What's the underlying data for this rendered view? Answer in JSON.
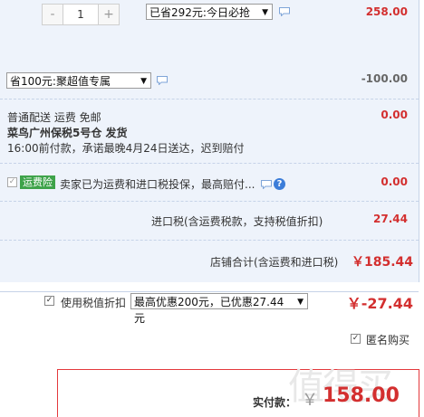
{
  "item": {
    "qty_minus": "-",
    "qty_value": "1",
    "qty_plus": "+",
    "promo_select": "已省292元:今日必抢",
    "price": "258.00"
  },
  "coupon": {
    "select": "省100元:聚超值专属",
    "amount": "-100.00"
  },
  "shipping": {
    "line1": "普通配送 运费 免邮",
    "line2": "菜鸟广州保税5号仓  发货",
    "line3": "16:00前付款，承诺最晚4月24日送达，迟到赔付",
    "amount": "0.00"
  },
  "insurance": {
    "tag": "运费险",
    "text": "卖家已为运费和进口税投保，最高赔付...",
    "help": "?",
    "amount": "0.00"
  },
  "import_tax": {
    "label": "进口税(含运费税款，支持税值折扣)",
    "amount": "27.44"
  },
  "shop_total": {
    "label": "店铺合计(含运费和进口税)",
    "amount": "￥185.44"
  },
  "tax_discount": {
    "checkbox_label": "使用税值折扣",
    "select": "最高优惠200元，已优惠27.44元",
    "amount": "￥-27.44"
  },
  "anonymous": {
    "label": "匿名购买"
  },
  "payment": {
    "label": "实付款：",
    "currency": "￥",
    "amount": "158.00"
  },
  "watermark": "值得买",
  "colors": {
    "accent_red": "#d32f2f",
    "panel_bg": "#eef3fb",
    "tag_green": "#3ea34a"
  }
}
